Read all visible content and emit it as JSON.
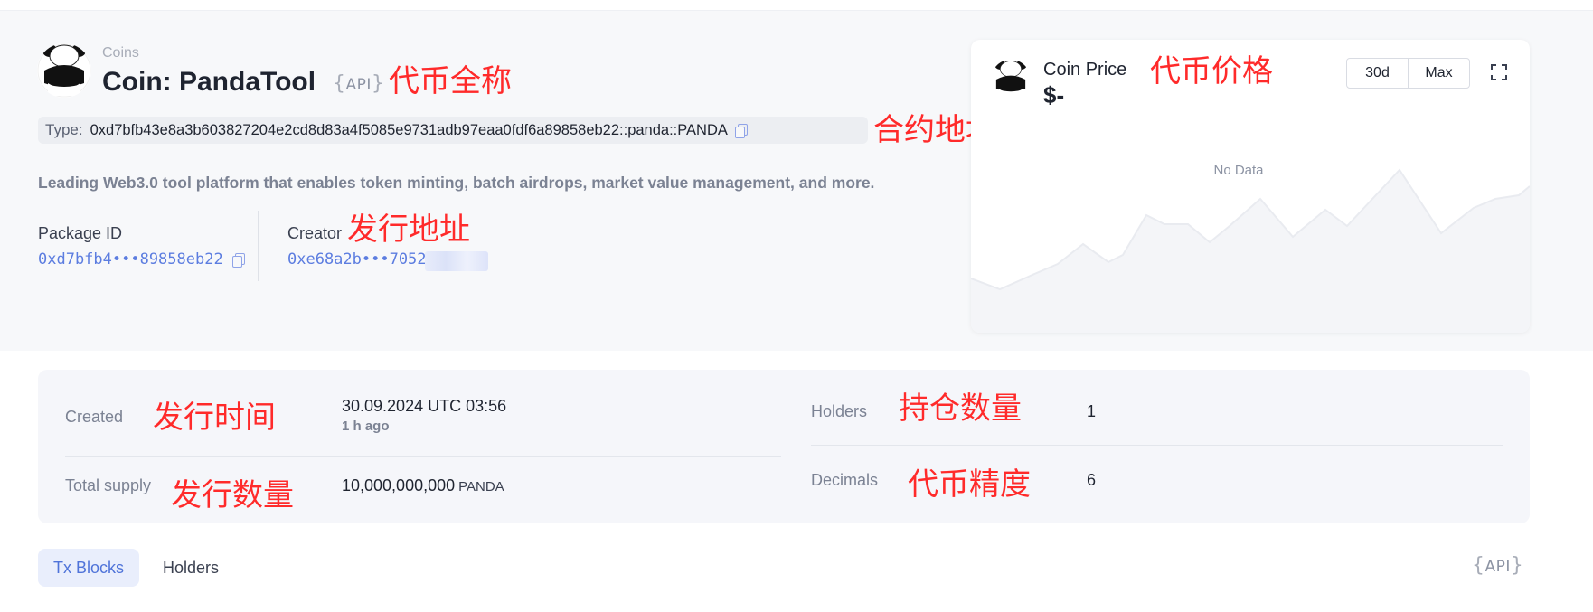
{
  "breadcrumb": "Coins",
  "coin": {
    "title": "Coin: PandaTool",
    "api_badge": "API",
    "type_label": "Type:",
    "type_value": "0xd7bfb43e8a3b603827204e2cd8d83a4f5085e9731adb97eaa0fdf6a89858eb22::panda::PANDA",
    "description": "Leading Web3.0 tool platform that enables token minting, batch airdrops, market value management, and more.",
    "package_label": "Package ID",
    "package_value": "0xd7bfb4•••89858eb22",
    "creator_label": "Creator",
    "creator_value": "0xe68a2b•••7052"
  },
  "annotations": {
    "full_name": "代币全称",
    "contract_address": "合约地址",
    "issuer_address": "发行地址",
    "price": "代币价格",
    "issue_time": "发行时间",
    "holders_count": "持仓数量",
    "issue_amount": "发行数量",
    "precision": "代币精度"
  },
  "price_card": {
    "title": "Coin Price",
    "price": "$-",
    "range_30d": "30d",
    "range_max": "Max",
    "no_data": "No Data"
  },
  "stats": {
    "created_label": "Created",
    "created_value": "30.09.2024 UTC 03:56",
    "created_ago": "1 h ago",
    "holders_label": "Holders",
    "holders_value": "1",
    "supply_label": "Total supply",
    "supply_value": "10,000,000,000",
    "supply_unit": "PANDA",
    "decimals_label": "Decimals",
    "decimals_value": "6"
  },
  "tabs": {
    "tx_blocks": "Tx Blocks",
    "holders": "Holders",
    "api_badge": "API"
  },
  "colors": {
    "annotation": "#ff2a2a",
    "link": "#5c7de0",
    "active_tab": "#4f73d9"
  }
}
